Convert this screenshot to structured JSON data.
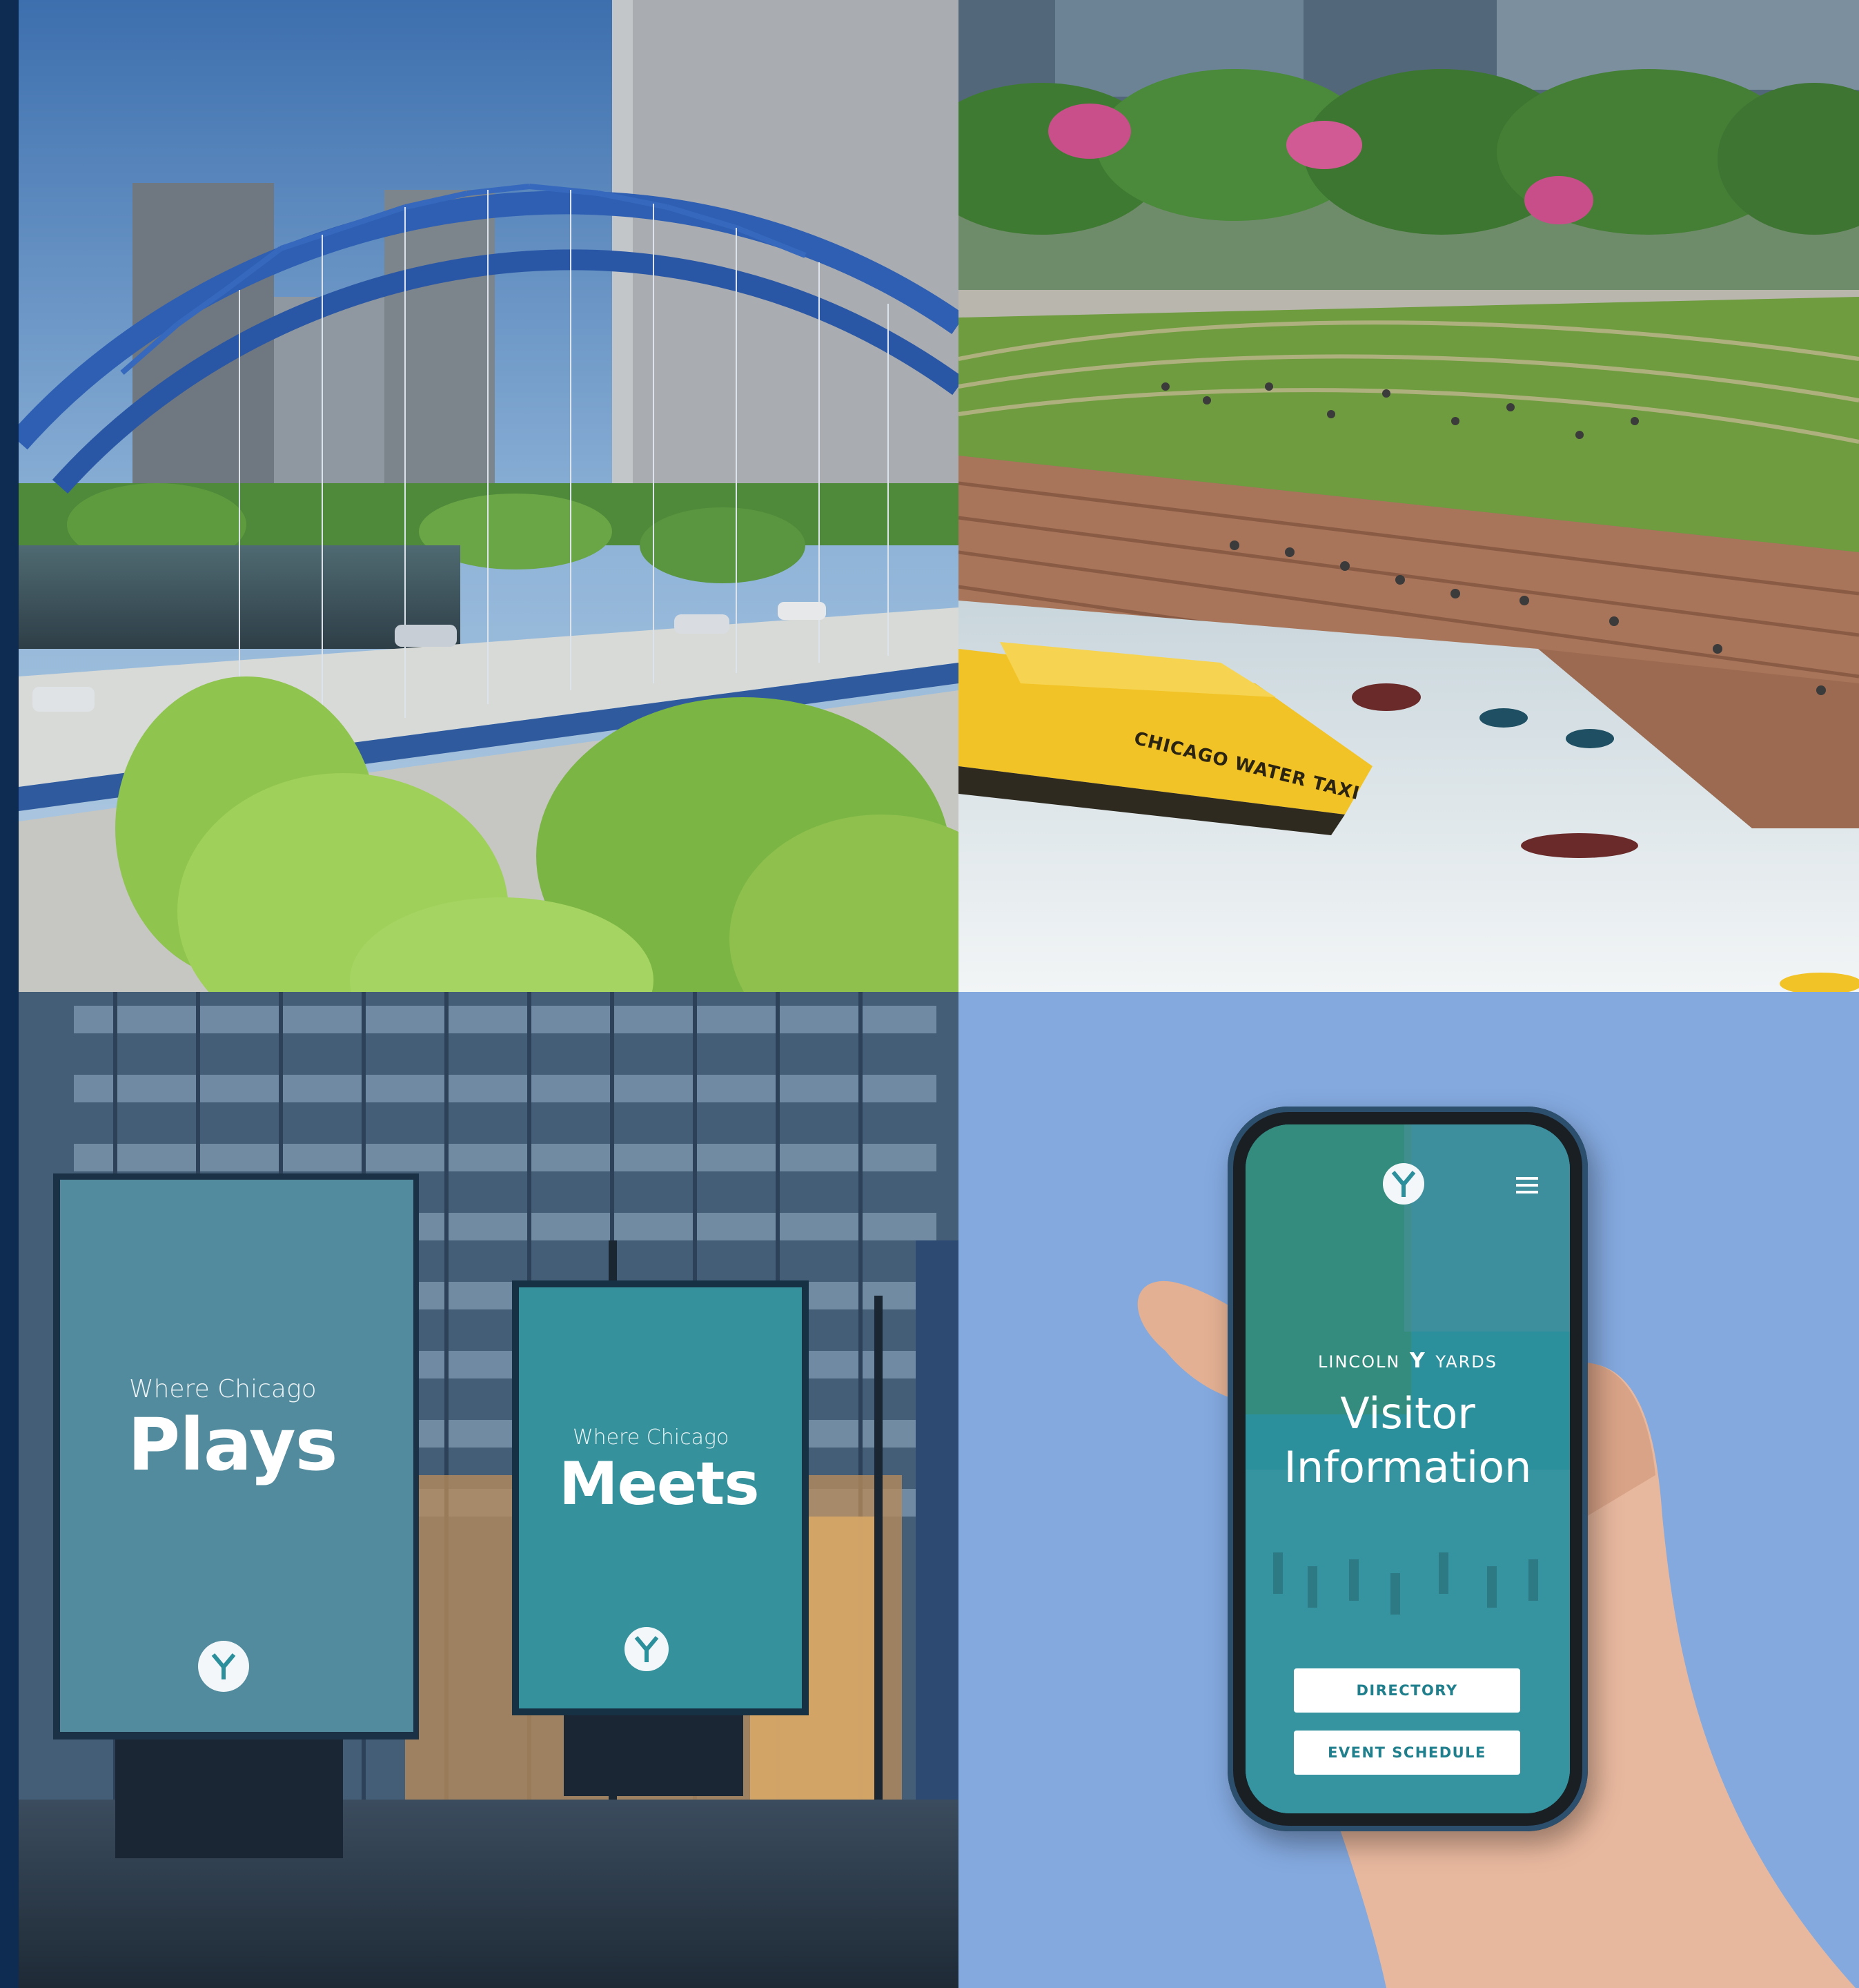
{
  "tiles": {
    "bridge": {
      "alt": ""
    },
    "riverfront": {
      "boat_label": "CHICAGO WATER TAXI"
    },
    "signage": {
      "left_sign": {
        "small": "Where Chicago",
        "big": "Plays"
      },
      "right_sign": {
        "small": "Where Chicago",
        "big": "Meets"
      }
    },
    "phone": {
      "brand_left": "LINCOLN",
      "brand_right": "YARDS",
      "title_line1": "Visitor",
      "title_line2": "Information",
      "buttons": [
        "DIRECTORY",
        "EVENT SCHEDULE"
      ],
      "menu_icon": "hamburger-menu-icon",
      "logo_icon": "lincoln-yards-y-logo-icon"
    }
  },
  "colors": {
    "frame": "#0e2b52",
    "bridge_arch": "#2e5fb3",
    "water_taxi": "#f2c326",
    "teal_overlay": "#2c8f9c",
    "background_blue": "#84a9df"
  }
}
